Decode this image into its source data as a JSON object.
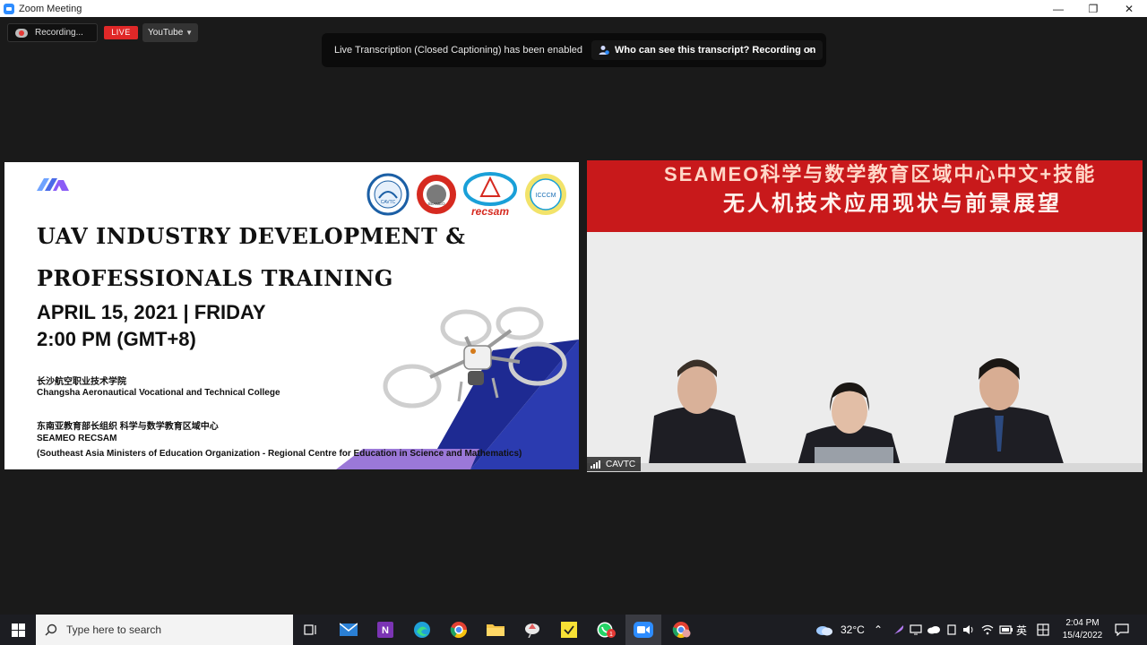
{
  "window": {
    "title": "Zoom Meeting",
    "minimize": "—",
    "maximize": "❐",
    "close": "✕"
  },
  "toolbar": {
    "recording": "Recording...",
    "live": "LIVE",
    "stream_target": "YouTube"
  },
  "transcript_notice": {
    "message": "Live Transcription (Closed Captioning) has been enabled",
    "who_can_see": "Who can see this transcript? Recording on",
    "close": "×"
  },
  "slide": {
    "title_line1": "UAV INDUSTRY DEVELOPMENT &",
    "title_line2": "PROFESSIONALS TRAINING",
    "date": "APRIL 15, 2021 | FRIDAY",
    "time": "2:00 PM (GMT+8)",
    "org1_cn": "长沙航空职业技术学院",
    "org1_en": "Changsha Aeronautical Vocational and Technical College",
    "org2_cn": "东南亚教育部长组织 科学与数学教育区域中心",
    "org2_en": "SEAMEO RECSAM",
    "org2_full": "(Southeast Asia Ministers of Education Organization - Regional Centre for Education in Science and Mathematics)",
    "logo_labels": {
      "cavtc": "CAVTC",
      "seameo": "SEAMEO",
      "recsam": "recsam",
      "icccm": "ICCCM"
    }
  },
  "video": {
    "banner_line1": "SEAMEO科学与数学教育区域中心中文+技能",
    "banner_line2": "无人机技术应用现状与前景展望",
    "participant_name": "CAVTC"
  },
  "taskbar": {
    "search_placeholder": "Type here to search",
    "weather_temp": "32°C",
    "ime": "英",
    "time": "2:04 PM",
    "date": "15/4/2022",
    "whatsapp_badge": "1"
  }
}
